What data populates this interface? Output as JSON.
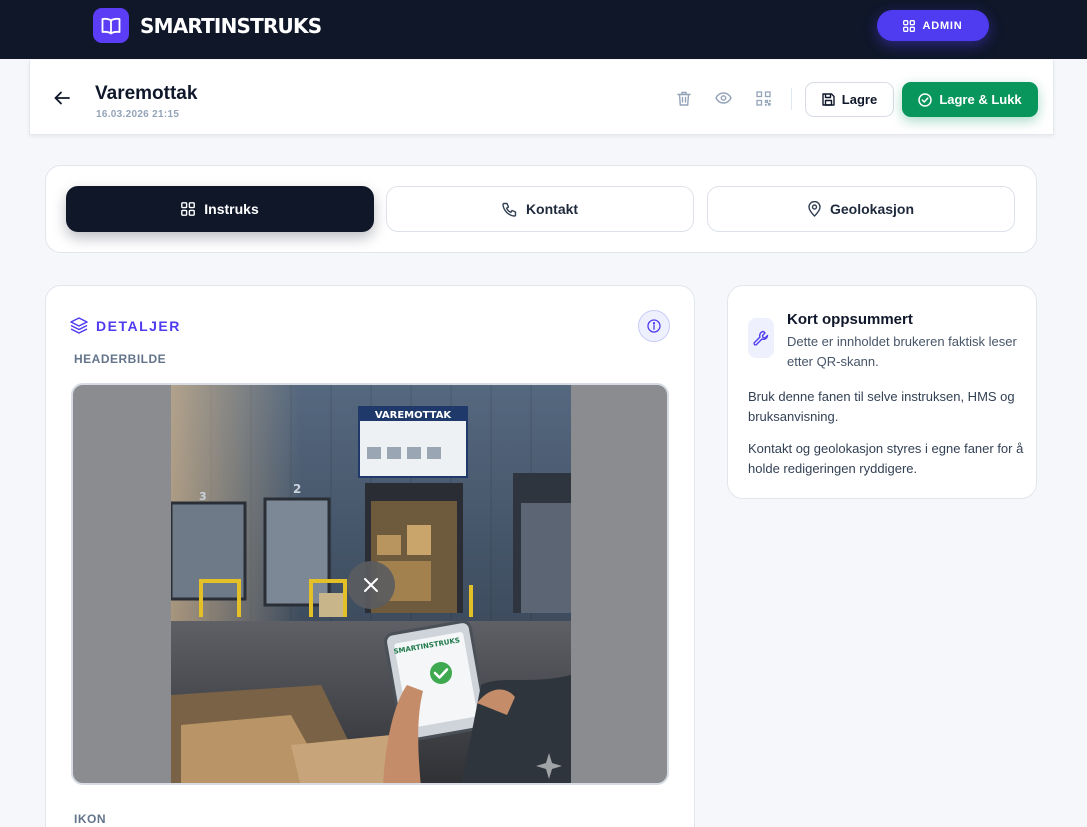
{
  "app": {
    "name": "SMARTINSTRUKS",
    "admin_label": "ADMIN",
    "logo_icon": "book-open-icon"
  },
  "header": {
    "title": "Varemottak",
    "date": "16.03.2026 21:15",
    "save_label": "Lagre",
    "save_close_label": "Lagre & Lukk",
    "tools": [
      "trash-icon",
      "eye-icon",
      "qr-code-icon"
    ]
  },
  "tabs": [
    {
      "label": "Instruks",
      "icon": "grid-icon",
      "active": true
    },
    {
      "label": "Kontakt",
      "icon": "phone-icon",
      "active": false
    },
    {
      "label": "Geolokasjon",
      "icon": "map-pin-icon",
      "active": false
    }
  ],
  "details": {
    "section_title": "DETALJER",
    "header_image_label": "HEADERBILDE",
    "icon_label": "IKON",
    "photo": {
      "sign": "VAREMOTTAK",
      "tablet_brand": "SMARTINSTRUKS",
      "door_numbers": [
        "3",
        "2"
      ]
    }
  },
  "summary": {
    "title": "Kort oppsummert",
    "subtitle": "Dette er innholdet brukeren faktisk leser etter QR-skann.",
    "paragraph1": "Bruk denne fanen til selve instruksen, HMS og bruksanvisning.",
    "paragraph2": "Kontakt og geolokasjon styres i egne faner for å holde redigeringen ryddigere."
  },
  "colors": {
    "navbar": "#0f1729",
    "accent": "#4f3cf0",
    "success": "#08965c",
    "background": "#f5f7fa"
  }
}
